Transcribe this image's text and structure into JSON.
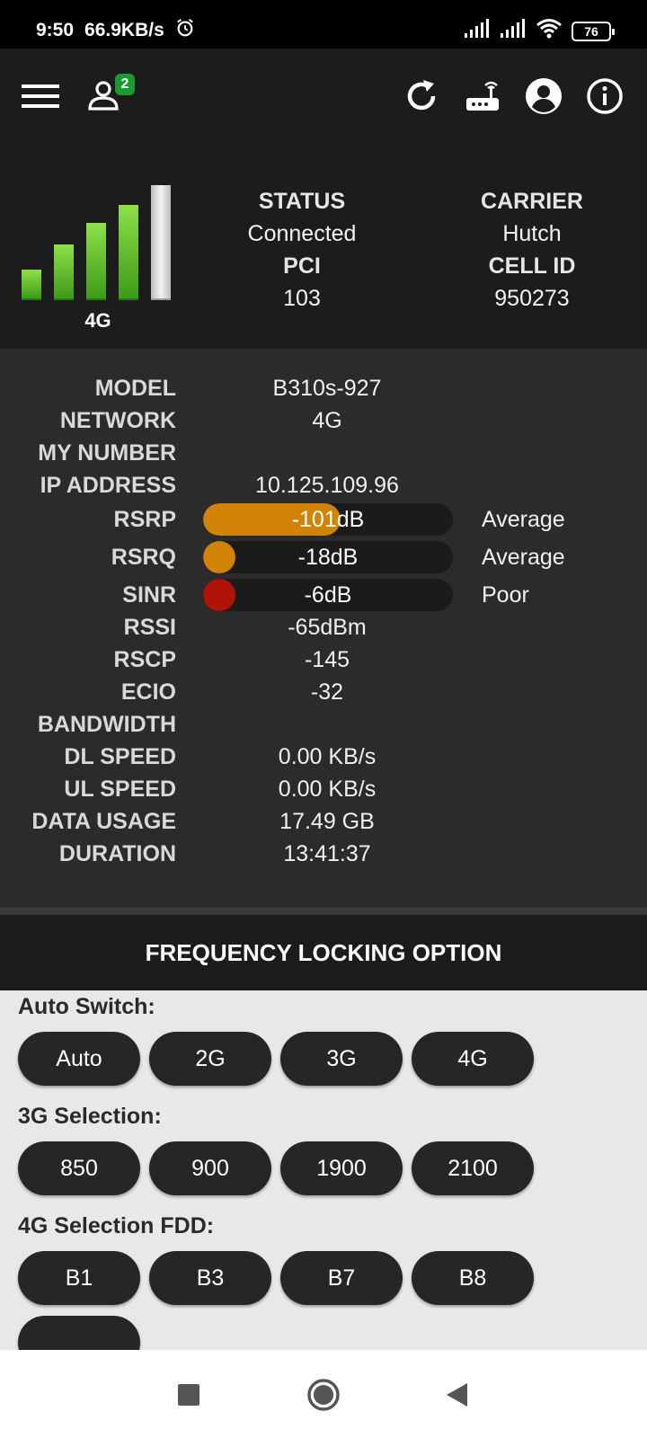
{
  "status_bar": {
    "time": "9:50",
    "net_speed": "66.9KB/s",
    "battery": "76",
    "icons": [
      "alarm-icon",
      "signal-icon",
      "signal-icon",
      "wifi-icon",
      "battery-icon"
    ]
  },
  "app_bar": {
    "icons": [
      "menu-icon",
      "users-icon",
      "refresh-icon",
      "router-icon",
      "account-icon",
      "info-icon"
    ],
    "users_badge": "2"
  },
  "summary": {
    "network_type": "4G",
    "signal_bars_total": 5,
    "signal_bars_active": 4,
    "status_label": "STATUS",
    "status_value": "Connected",
    "pci_label": "PCI",
    "pci_value": "103",
    "carrier_label": "CARRIER",
    "carrier_value": "Hutch",
    "cellid_label": "CELL ID",
    "cellid_value": "950273"
  },
  "details": {
    "model": {
      "label": "MODEL",
      "value": "B310s-927"
    },
    "network": {
      "label": "NETWORK",
      "value": "4G"
    },
    "my_number": {
      "label": "MY NUMBER",
      "value": ""
    },
    "ip": {
      "label": "IP ADDRESS",
      "value": "10.125.109.96"
    },
    "rsrp": {
      "label": "RSRP",
      "value": "-101dB",
      "quality": "Average",
      "level": 0.55,
      "color": "#d08305"
    },
    "rsrq": {
      "label": "RSRQ",
      "value": "-18dB",
      "quality": "Average",
      "level": 0.13,
      "color": "#d08305"
    },
    "sinr": {
      "label": "SINR",
      "value": "-6dB",
      "quality": "Poor",
      "level": 0.1,
      "color": "#b01208"
    },
    "rssi": {
      "label": "RSSI",
      "value": "-65dBm"
    },
    "rscp": {
      "label": "RSCP",
      "value": "-145"
    },
    "ecio": {
      "label": "ECIO",
      "value": "-32"
    },
    "bandwidth": {
      "label": "BANDWIDTH",
      "value": ""
    },
    "dl_speed": {
      "label": "DL SPEED",
      "value": "0.00 KB/s"
    },
    "ul_speed": {
      "label": "UL SPEED",
      "value": "0.00 KB/s"
    },
    "data_usage": {
      "label": "DATA USAGE",
      "value": "17.49 GB"
    },
    "duration": {
      "label": "DURATION",
      "value": "13:41:37"
    }
  },
  "frequency": {
    "title": "FREQUENCY LOCKING OPTION",
    "auto_switch": {
      "title": "Auto Switch:",
      "options": [
        "Auto",
        "2G",
        "3G",
        "4G"
      ]
    },
    "g3_selection": {
      "title": "3G Selection:",
      "options": [
        "850",
        "900",
        "1900",
        "2100"
      ]
    },
    "g4_fdd": {
      "title": "4G Selection FDD:",
      "options": [
        "B1",
        "B3",
        "B7",
        "B8"
      ]
    }
  },
  "nav_bar": {
    "icons": [
      "recents-icon",
      "home-icon",
      "back-icon"
    ]
  }
}
